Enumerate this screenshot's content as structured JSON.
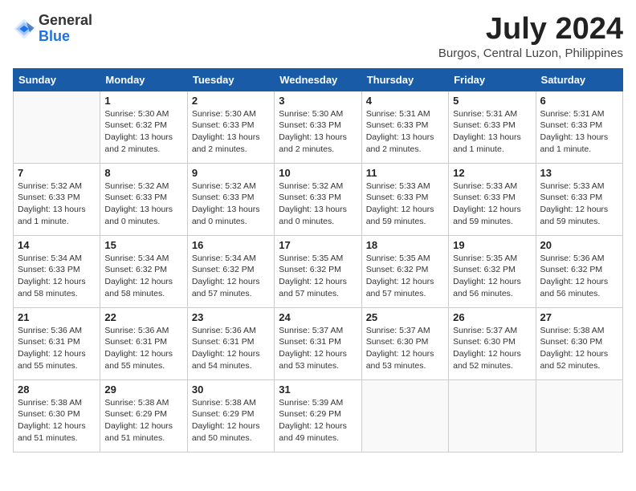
{
  "logo": {
    "line1": "General",
    "line2": "Blue"
  },
  "title": "July 2024",
  "location": "Burgos, Central Luzon, Philippines",
  "weekdays": [
    "Sunday",
    "Monday",
    "Tuesday",
    "Wednesday",
    "Thursday",
    "Friday",
    "Saturday"
  ],
  "weeks": [
    [
      {
        "day": "",
        "info": ""
      },
      {
        "day": "1",
        "info": "Sunrise: 5:30 AM\nSunset: 6:32 PM\nDaylight: 13 hours\nand 2 minutes."
      },
      {
        "day": "2",
        "info": "Sunrise: 5:30 AM\nSunset: 6:33 PM\nDaylight: 13 hours\nand 2 minutes."
      },
      {
        "day": "3",
        "info": "Sunrise: 5:30 AM\nSunset: 6:33 PM\nDaylight: 13 hours\nand 2 minutes."
      },
      {
        "day": "4",
        "info": "Sunrise: 5:31 AM\nSunset: 6:33 PM\nDaylight: 13 hours\nand 2 minutes."
      },
      {
        "day": "5",
        "info": "Sunrise: 5:31 AM\nSunset: 6:33 PM\nDaylight: 13 hours\nand 1 minute."
      },
      {
        "day": "6",
        "info": "Sunrise: 5:31 AM\nSunset: 6:33 PM\nDaylight: 13 hours\nand 1 minute."
      }
    ],
    [
      {
        "day": "7",
        "info": "Sunrise: 5:32 AM\nSunset: 6:33 PM\nDaylight: 13 hours\nand 1 minute."
      },
      {
        "day": "8",
        "info": "Sunrise: 5:32 AM\nSunset: 6:33 PM\nDaylight: 13 hours\nand 0 minutes."
      },
      {
        "day": "9",
        "info": "Sunrise: 5:32 AM\nSunset: 6:33 PM\nDaylight: 13 hours\nand 0 minutes."
      },
      {
        "day": "10",
        "info": "Sunrise: 5:32 AM\nSunset: 6:33 PM\nDaylight: 13 hours\nand 0 minutes."
      },
      {
        "day": "11",
        "info": "Sunrise: 5:33 AM\nSunset: 6:33 PM\nDaylight: 12 hours\nand 59 minutes."
      },
      {
        "day": "12",
        "info": "Sunrise: 5:33 AM\nSunset: 6:33 PM\nDaylight: 12 hours\nand 59 minutes."
      },
      {
        "day": "13",
        "info": "Sunrise: 5:33 AM\nSunset: 6:33 PM\nDaylight: 12 hours\nand 59 minutes."
      }
    ],
    [
      {
        "day": "14",
        "info": "Sunrise: 5:34 AM\nSunset: 6:33 PM\nDaylight: 12 hours\nand 58 minutes."
      },
      {
        "day": "15",
        "info": "Sunrise: 5:34 AM\nSunset: 6:32 PM\nDaylight: 12 hours\nand 58 minutes."
      },
      {
        "day": "16",
        "info": "Sunrise: 5:34 AM\nSunset: 6:32 PM\nDaylight: 12 hours\nand 57 minutes."
      },
      {
        "day": "17",
        "info": "Sunrise: 5:35 AM\nSunset: 6:32 PM\nDaylight: 12 hours\nand 57 minutes."
      },
      {
        "day": "18",
        "info": "Sunrise: 5:35 AM\nSunset: 6:32 PM\nDaylight: 12 hours\nand 57 minutes."
      },
      {
        "day": "19",
        "info": "Sunrise: 5:35 AM\nSunset: 6:32 PM\nDaylight: 12 hours\nand 56 minutes."
      },
      {
        "day": "20",
        "info": "Sunrise: 5:36 AM\nSunset: 6:32 PM\nDaylight: 12 hours\nand 56 minutes."
      }
    ],
    [
      {
        "day": "21",
        "info": "Sunrise: 5:36 AM\nSunset: 6:31 PM\nDaylight: 12 hours\nand 55 minutes."
      },
      {
        "day": "22",
        "info": "Sunrise: 5:36 AM\nSunset: 6:31 PM\nDaylight: 12 hours\nand 55 minutes."
      },
      {
        "day": "23",
        "info": "Sunrise: 5:36 AM\nSunset: 6:31 PM\nDaylight: 12 hours\nand 54 minutes."
      },
      {
        "day": "24",
        "info": "Sunrise: 5:37 AM\nSunset: 6:31 PM\nDaylight: 12 hours\nand 53 minutes."
      },
      {
        "day": "25",
        "info": "Sunrise: 5:37 AM\nSunset: 6:30 PM\nDaylight: 12 hours\nand 53 minutes."
      },
      {
        "day": "26",
        "info": "Sunrise: 5:37 AM\nSunset: 6:30 PM\nDaylight: 12 hours\nand 52 minutes."
      },
      {
        "day": "27",
        "info": "Sunrise: 5:38 AM\nSunset: 6:30 PM\nDaylight: 12 hours\nand 52 minutes."
      }
    ],
    [
      {
        "day": "28",
        "info": "Sunrise: 5:38 AM\nSunset: 6:30 PM\nDaylight: 12 hours\nand 51 minutes."
      },
      {
        "day": "29",
        "info": "Sunrise: 5:38 AM\nSunset: 6:29 PM\nDaylight: 12 hours\nand 51 minutes."
      },
      {
        "day": "30",
        "info": "Sunrise: 5:38 AM\nSunset: 6:29 PM\nDaylight: 12 hours\nand 50 minutes."
      },
      {
        "day": "31",
        "info": "Sunrise: 5:39 AM\nSunset: 6:29 PM\nDaylight: 12 hours\nand 49 minutes."
      },
      {
        "day": "",
        "info": ""
      },
      {
        "day": "",
        "info": ""
      },
      {
        "day": "",
        "info": ""
      }
    ]
  ]
}
